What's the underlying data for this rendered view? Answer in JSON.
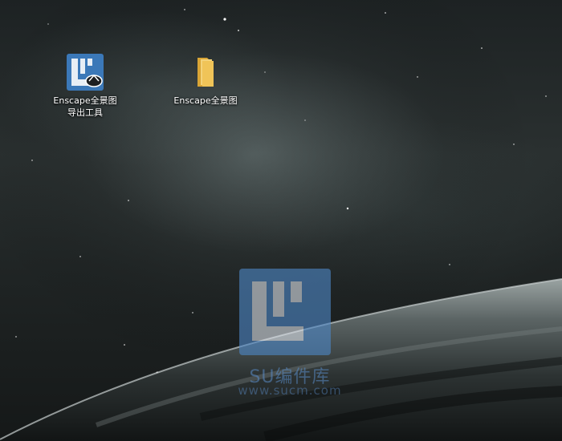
{
  "desktop": {
    "icons": [
      {
        "label": "Enscape全景图导出工具",
        "icon": "enscape-app-icon"
      },
      {
        "label": "Enscape全景图",
        "icon": "folder-icon"
      }
    ]
  },
  "watermark": {
    "text": "SU编件库",
    "url": "www.sucm.com",
    "color": "#5a8cc8"
  }
}
